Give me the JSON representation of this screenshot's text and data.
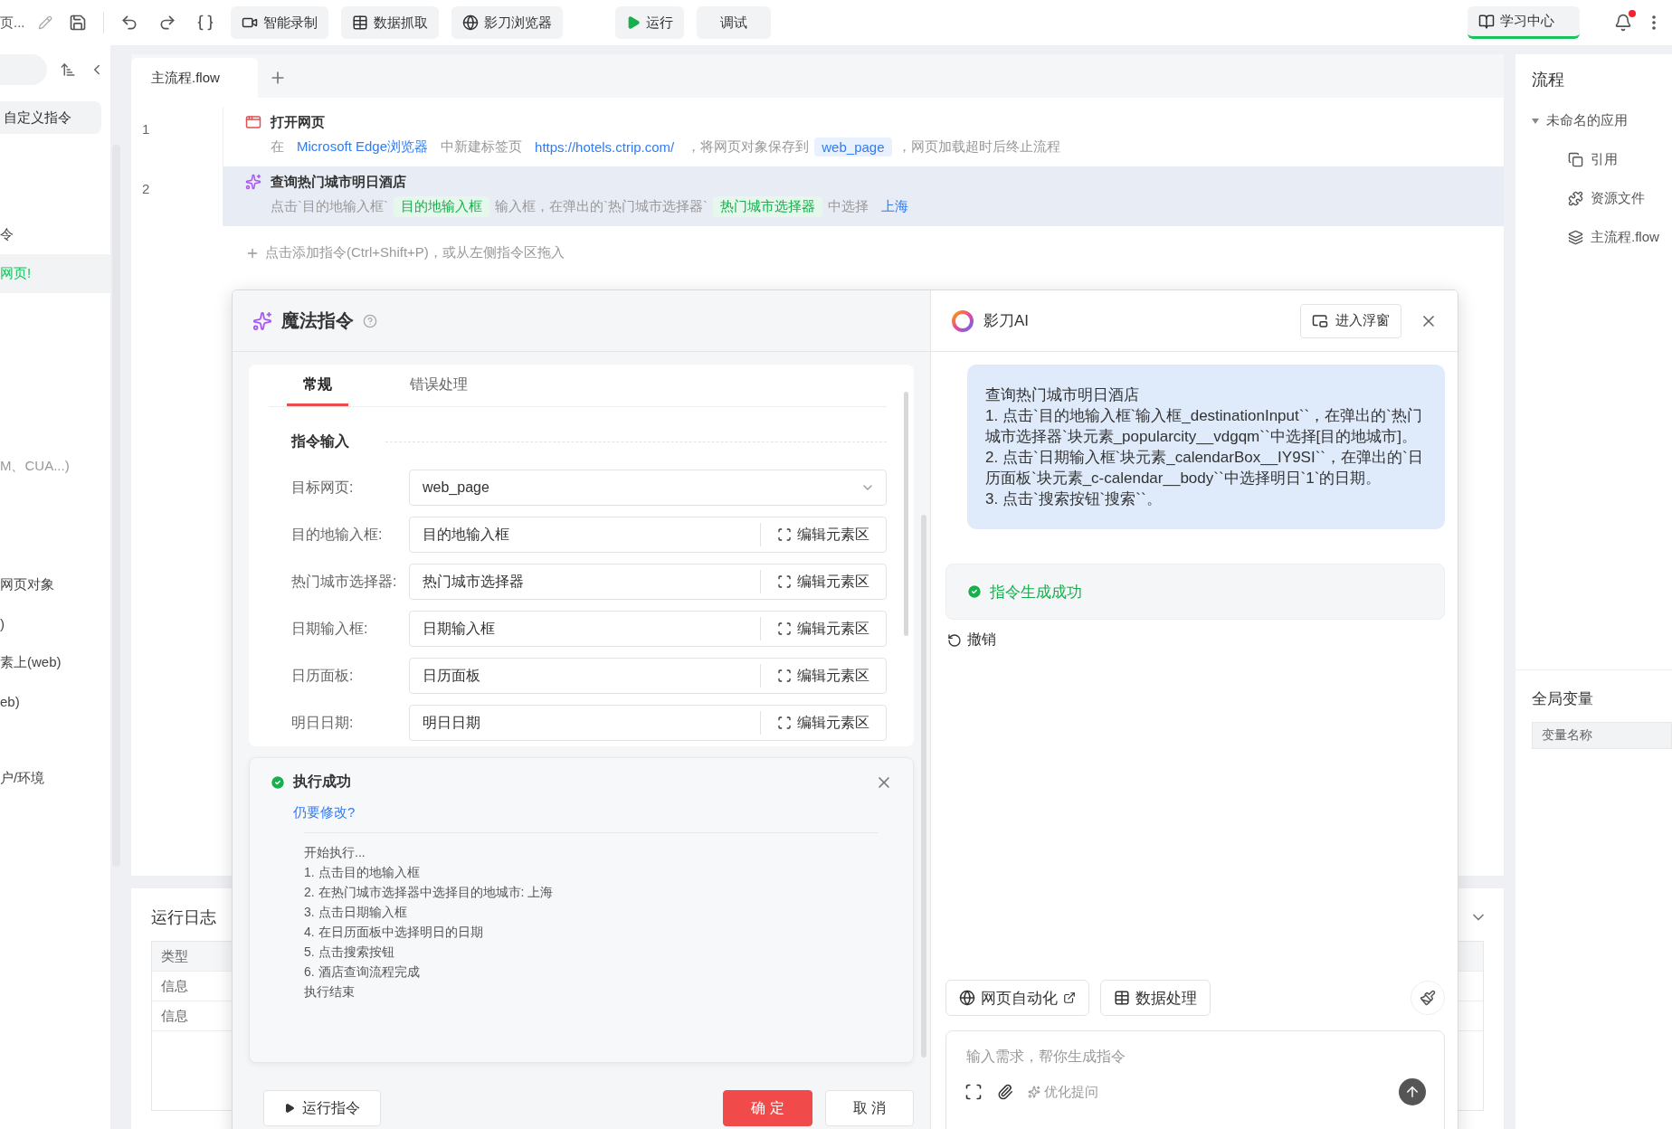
{
  "toolbar": {
    "title": "页...",
    "tools": [
      {
        "kind": "record",
        "label": "智能录制"
      },
      {
        "kind": "grab",
        "label": "数据抓取"
      },
      {
        "kind": "browser",
        "label": "影刀浏览器"
      }
    ],
    "run": "运行",
    "debug": "调试",
    "learn": "学习中心",
    "unread": true
  },
  "sidebar": {
    "custom": "自定义指令",
    "groups": [
      [
        {
          "label": "令",
          "selected": false,
          "muted": false
        },
        {
          "label": "网页!",
          "selected": true,
          "muted": false
        }
      ],
      [
        {
          "label": "M、CUA...)",
          "selected": false,
          "muted": true
        }
      ],
      [
        {
          "label": "网页对象",
          "selected": false,
          "muted": false
        },
        {
          "label": ")",
          "selected": false,
          "muted": false
        },
        {
          "label": "素上(web)",
          "selected": false,
          "muted": false
        },
        {
          "label": "eb)",
          "selected": false,
          "muted": false
        }
      ],
      [
        {
          "label": "户/环境",
          "selected": false,
          "muted": false
        }
      ]
    ]
  },
  "editor": {
    "tabs": [
      {
        "label": "主流程.flow",
        "selected": true
      }
    ],
    "rows": [
      {
        "number": "1",
        "kind": "web",
        "title": "打开网页",
        "selected": false,
        "parts": [
          {
            "kind": "text",
            "text": "在"
          },
          {
            "kind": "link",
            "text": "Microsoft Edge浏览器"
          },
          {
            "kind": "text",
            "text": "中新建标签页"
          },
          {
            "kind": "link",
            "text": "https://hotels.ctrip.com/"
          },
          {
            "kind": "text",
            "text": "，将网页对象保存到"
          },
          {
            "kind": "variable",
            "text": "web_page"
          },
          {
            "kind": "text",
            "text": "，网页加载超时后终止流程"
          }
        ]
      },
      {
        "number": "2",
        "kind": "magic",
        "title": "查询热门城市明日酒店",
        "selected": true,
        "parts": [
          {
            "kind": "text",
            "text": "点击`目的地输入框`"
          },
          {
            "kind": "element",
            "text": "目的地输入框"
          },
          {
            "kind": "text",
            "text": "输入框，在弹出的`热门城市选择器`"
          },
          {
            "kind": "element",
            "text": "热门城市选择器"
          },
          {
            "kind": "text",
            "text": "中选择"
          },
          {
            "kind": "link",
            "text": "上海"
          }
        ]
      }
    ],
    "add_hint": "点击添加指令(Ctrl+Shift+P)，或从左侧指令区拖入"
  },
  "run_log": {
    "title": "运行日志",
    "columns": [
      "类型"
    ],
    "rows": [
      "信息",
      "信息"
    ]
  },
  "right_panel": {
    "title": "流程",
    "tree": [
      {
        "label": "未命名的应用",
        "expanded": true,
        "children": [
          {
            "label": "引用",
            "kind": "reference"
          },
          {
            "label": "资源文件",
            "kind": "resource"
          },
          {
            "label": "主流程.flow",
            "kind": "flow"
          }
        ]
      }
    ],
    "variables_title": "全局变量",
    "variables_columns": [
      "变量名称"
    ]
  },
  "dialog": {
    "title": "魔法指令",
    "tabs": [
      {
        "label": "常规",
        "selected": true
      },
      {
        "label": "错误处理",
        "selected": false
      }
    ],
    "section": "指令输入",
    "fields": [
      {
        "kind": "select",
        "label": "目标网页:",
        "value": "web_page"
      },
      {
        "kind": "element",
        "label": "目的地输入框:",
        "value": "目的地输入框",
        "action": "编辑元素区"
      },
      {
        "kind": "element",
        "label": "热门城市选择器:",
        "value": "热门城市选择器",
        "action": "编辑元素区"
      },
      {
        "kind": "element",
        "label": "日期输入框:",
        "value": "日期输入框",
        "action": "编辑元素区"
      },
      {
        "kind": "element",
        "label": "日历面板:",
        "value": "日历面板",
        "action": "编辑元素区"
      },
      {
        "kind": "element",
        "label": "明日日期:",
        "value": "明日日期",
        "action": "编辑元素区"
      }
    ],
    "result": {
      "title": "执行成功",
      "link": "仍要修改?",
      "lines": [
        "开始执行...",
        "1. 点击目的地输入框",
        "2. 在热门城市选择器中选择目的地城市: 上海",
        "3. 点击日期输入框",
        "4. 在日历面板中选择明日的日期",
        "5. 点击搜索按钮",
        "6. 酒店查询流程完成",
        "执行结束"
      ]
    },
    "run_button": "运行指令",
    "ok": "确 定",
    "cancel": "取 消"
  },
  "ai": {
    "title": "影刀AI",
    "float_button": "进入浮窗",
    "message": [
      "查询热门城市明日酒店",
      "1. 点击`目的地输入框`输入框_destinationInput``，在弹出的`热门城市选择器`块元素_popularcity__vdgqm``中选择[目的地城市]。",
      "2. 点击`日期输入框`块元素_calendarBox__IY9SI``，在弹出的`日历面板`块元素_c-calendar__body``中选择明日`1`的日期。",
      "3. 点击`搜索按钮`搜索``。"
    ],
    "status": "指令生成成功",
    "undo": "撤销",
    "chips": [
      {
        "kind": "web",
        "label": "网页自动化"
      },
      {
        "kind": "data",
        "label": "数据处理"
      }
    ],
    "placeholder": "输入需求，帮你生成指令",
    "optimize": "优化提问"
  }
}
